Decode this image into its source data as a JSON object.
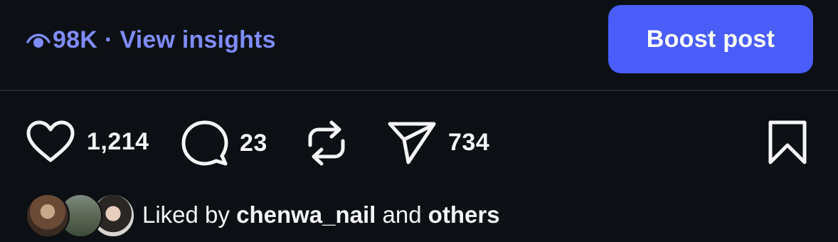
{
  "insights": {
    "views": "98K",
    "separator": "·",
    "link_label": "View insights"
  },
  "boost": {
    "label": "Boost post"
  },
  "actions": {
    "likes": "1,214",
    "comments": "23",
    "shares": "734"
  },
  "liked_by": {
    "prefix": "Liked by",
    "user": "chenwa_nail",
    "connector": "and",
    "others": "others"
  },
  "colors": {
    "background": "#0c1015",
    "accent_link": "#7f8cf6",
    "button": "#4a5dfa",
    "text": "#f5f5f5"
  },
  "icons": [
    "eye-icon",
    "heart-icon",
    "comment-icon",
    "repost-icon",
    "send-icon",
    "bookmark-icon"
  ]
}
